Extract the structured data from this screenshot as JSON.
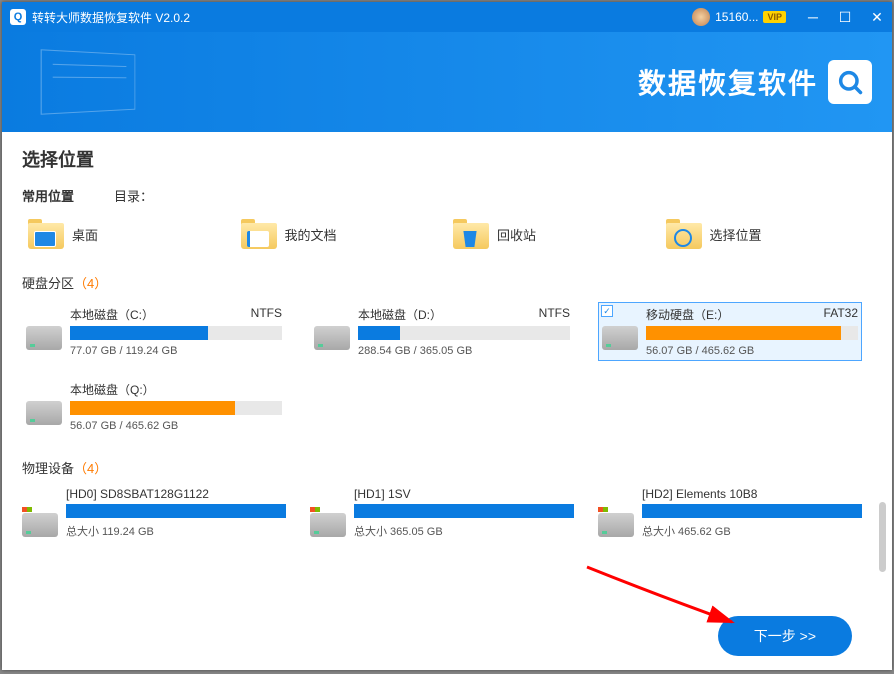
{
  "titlebar": {
    "app_title": "转转大师数据恢复软件 V2.0.2",
    "username": "15160...",
    "vip_label": "VIP"
  },
  "banner": {
    "title": "数据恢复软件"
  },
  "content": {
    "heading": "选择位置",
    "common_label": "常用位置",
    "directory_label": "目录：",
    "common_items": [
      {
        "label": "桌面",
        "icon": "desktop"
      },
      {
        "label": "我的文档",
        "icon": "doc"
      },
      {
        "label": "回收站",
        "icon": "recycle"
      },
      {
        "label": "选择位置",
        "icon": "search"
      }
    ],
    "partitions_label": "硬盘分区",
    "partitions_count": "（4）",
    "partitions": [
      {
        "name": "本地磁盘（C:）",
        "fs": "NTFS",
        "used": "77.07 GB",
        "total": "119.24 GB",
        "pct": 65,
        "color": "blue",
        "selected": false
      },
      {
        "name": "本地磁盘（D:）",
        "fs": "NTFS",
        "used": "288.54 GB",
        "total": "365.05 GB",
        "pct": 20,
        "color": "blue",
        "selected": false
      },
      {
        "name": "移动硬盘（E:）",
        "fs": "FAT32",
        "used": "56.07 GB",
        "total": "465.62 GB",
        "pct": 92,
        "color": "orange",
        "selected": true
      },
      {
        "name": "本地磁盘（Q:）",
        "fs": "",
        "used": "56.07 GB",
        "total": "465.62 GB",
        "pct": 78,
        "color": "orange",
        "selected": false
      }
    ],
    "physical_label": "物理设备",
    "physical_count": "（4）",
    "physical": [
      {
        "name": "[HD0] SD8SBAT128G1122",
        "total_label": "总大小",
        "total": "119.24 GB"
      },
      {
        "name": "[HD1] 1SV",
        "total_label": "总大小",
        "total": "365.05 GB"
      },
      {
        "name": "[HD2] Elements 10B8",
        "total_label": "总大小",
        "total": "465.62 GB"
      }
    ]
  },
  "footer": {
    "next_label": "下一步 >>"
  }
}
